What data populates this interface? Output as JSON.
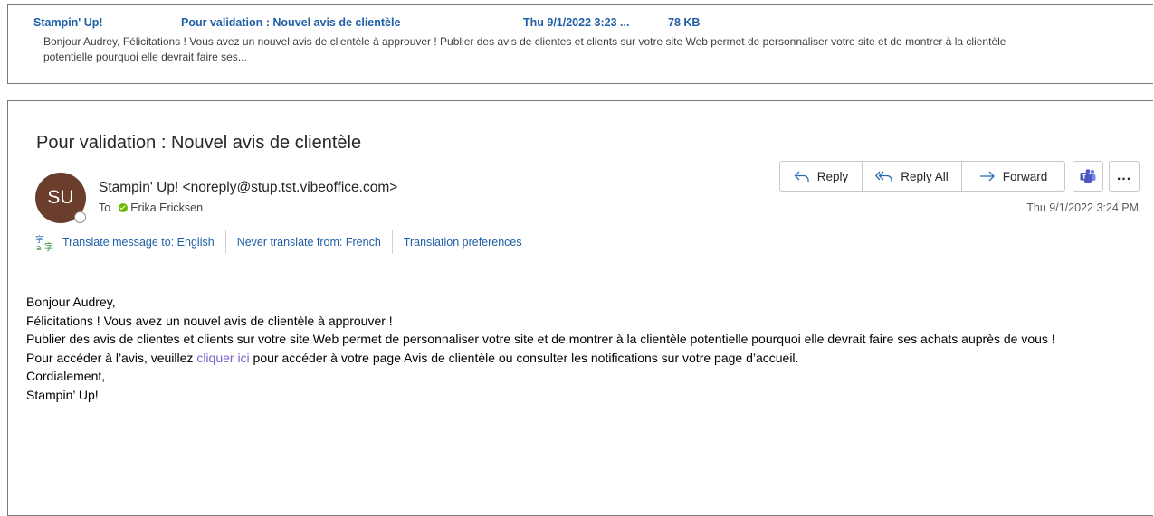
{
  "preview": {
    "sender": "Stampin' Up!",
    "subject": "Pour validation : Nouvel avis de clientèle",
    "date": "Thu 9/1/2022 3:23 ...",
    "size": "78 KB",
    "snippet": "Bonjour Audrey,  Félicitations ! Vous avez un nouvel avis de clientèle à approuver !  Publier des avis de clientes et clients sur votre site Web permet de personnaliser votre site et de montrer à la clientèle potentielle pourquoi elle devrait faire ses..."
  },
  "message": {
    "subject": "Pour validation : Nouvel avis de clientèle",
    "avatar_initials": "SU",
    "from": "Stampin' Up! <noreply@stup.tst.vibeoffice.com>",
    "to_label": "To",
    "recipient": "Erika Ericksen",
    "timestamp": "Thu 9/1/2022 3:24 PM",
    "avatar_color": "#6b3d2c",
    "presence_color": "#6bb700"
  },
  "actions": {
    "reply": "Reply",
    "reply_all": "Reply All",
    "forward": "Forward",
    "more": "..."
  },
  "translation": {
    "translate": "Translate message to: English",
    "never": "Never translate from: French",
    "prefs": "Translation preferences"
  },
  "body": {
    "greeting": "Bonjour Audrey,",
    "line1": "Félicitations ! Vous avez un nouvel avis de clientèle à approuver !",
    "line2": "Publier des avis de clientes et clients sur votre site Web permet de personnaliser votre site et de montrer à la clientèle potentielle pourquoi elle devrait faire ses achats auprès de vous !",
    "line3_before": "Pour accéder à l’avis, veuillez ",
    "line3_link": "cliquer ici",
    "line3_after": " pour accéder à votre page Avis de clientèle ou consulter les notifications sur votre page d’accueil.",
    "closing": "Cordialement,",
    "signature": "Stampin’ Up!"
  },
  "icons": {
    "reply": "reply-icon",
    "reply_all": "reply-all-icon",
    "forward": "forward-icon",
    "teams": "teams-icon",
    "translate": "translate-icon"
  },
  "colors": {
    "link": "#1f5fa6",
    "visited_link": "#7b5ec7",
    "teams": "#5059c9"
  }
}
